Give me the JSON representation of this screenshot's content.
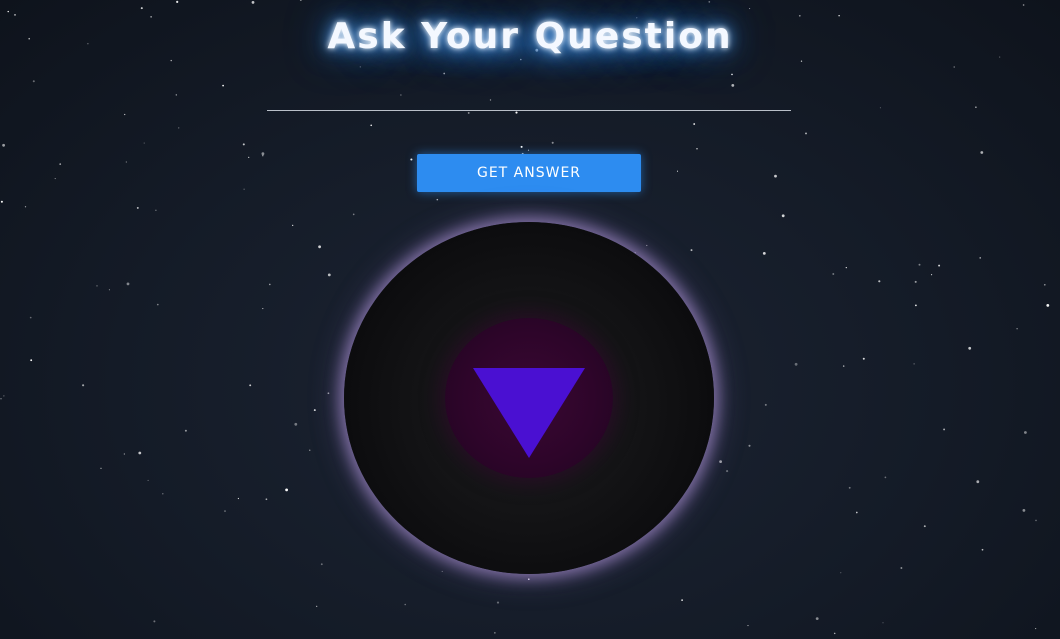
{
  "header": {
    "title": "Ask Your Question"
  },
  "question": {
    "value": "",
    "placeholder": ""
  },
  "controls": {
    "get_answer_label": "GET ANSWER"
  },
  "magic_ball": {
    "triangle_icon": "triangle-down-icon",
    "answer_text": ""
  },
  "colors": {
    "background": "#151c28",
    "title_glow": "#2a7fd4",
    "button": "#2d8cf0",
    "ball": "#0e0e10",
    "ball_halo": "#bea0e6",
    "window": "#2e052a",
    "triangle": "#4a10d2"
  }
}
